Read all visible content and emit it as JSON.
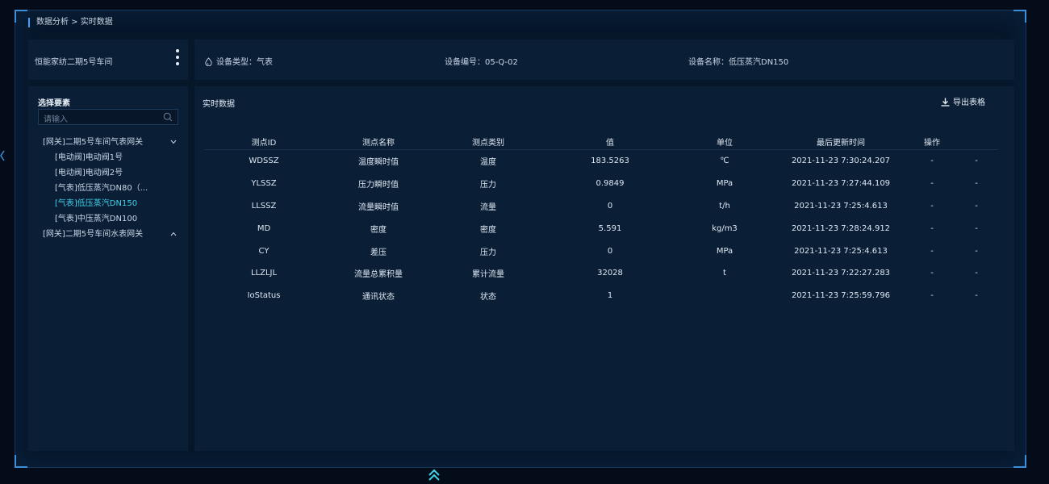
{
  "breadcrumb": "数据分析 > 实时数据",
  "left_header": {
    "workshop": "恒能家纺二期5号车间"
  },
  "device_info": {
    "type_label": "设备类型：",
    "type_value": "气表",
    "code_label": "设备编号：",
    "code_value": "05-Q-02",
    "name_label": "设备名称：",
    "name_value": "低压蒸汽DN150"
  },
  "selector": {
    "title": "选择要素",
    "search_placeholder": "请输入",
    "tree": [
      {
        "label": "[网关]二期5号车间气表网关",
        "level": 0,
        "expanded": true
      },
      {
        "label": "[电动阀]电动阀1号",
        "level": 1
      },
      {
        "label": "[电动阀]电动阀2号",
        "level": 1
      },
      {
        "label": "[气表]低压蒸汽DN80（...",
        "level": 1
      },
      {
        "label": "[气表]低压蒸汽DN150",
        "level": 1,
        "active": true
      },
      {
        "label": "[气表]中压蒸汽DN100",
        "level": 1
      },
      {
        "label": "[网关]二期5号车间水表网关",
        "level": 0,
        "expanded": false
      }
    ]
  },
  "realtime": {
    "title": "实时数据",
    "export_label": "导出表格",
    "columns": [
      "测点ID",
      "测点名称",
      "测点类别",
      "值",
      "单位",
      "最后更新时间",
      "操作",
      ""
    ],
    "rows": [
      [
        "WDSSZ",
        "温度瞬时值",
        "温度",
        "183.5263",
        "℃",
        "2021-11-23 7:30:24.207",
        "-",
        "-"
      ],
      [
        "YLSSZ",
        "压力瞬时值",
        "压力",
        "0.9849",
        "MPa",
        "2021-11-23 7:27:44.109",
        "-",
        "-"
      ],
      [
        "LLSSZ",
        "流量瞬时值",
        "流量",
        "0",
        "t/h",
        "2021-11-23 7:25:4.613",
        "-",
        "-"
      ],
      [
        "MD",
        "密度",
        "密度",
        "5.591",
        "kg/m3",
        "2021-11-23 7:28:24.912",
        "-",
        "-"
      ],
      [
        "CY",
        "差压",
        "压力",
        "0",
        "MPa",
        "2021-11-23 7:25:4.613",
        "-",
        "-"
      ],
      [
        "LLZLJL",
        "流量总累积量",
        "累计流量",
        "32028",
        "t",
        "2021-11-23 7:22:27.283",
        "-",
        "-"
      ],
      [
        "IoStatus",
        "通讯状态",
        "状态",
        "1",
        "",
        "2021-11-23 7:25:59.796",
        "-",
        "-"
      ]
    ]
  },
  "colors": {
    "accent": "#3aa0ff",
    "active": "#3fd2ea",
    "panel": "#0a1e35",
    "background": "#030c18"
  },
  "icons": [
    "more-vertical-icon",
    "drop-icon",
    "search-icon",
    "chevron-down-icon",
    "chevron-up-icon",
    "download-icon",
    "double-chevron-up-icon",
    "chevron-left-icon"
  ]
}
